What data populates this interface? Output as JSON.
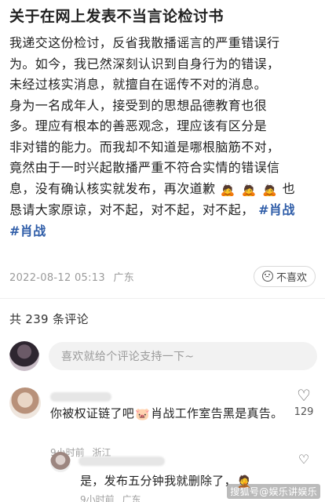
{
  "post": {
    "title": "关于在网上发表不当言论检讨书",
    "lines": [
      "我递交这份检讨，反省我散播谣言的严重错误行",
      "为。如今，我已然深刻认识到自身行为的错误，",
      "未经过核实消息，就擅自在谣传不对的消息。",
      "身为一名成年人，接受到的思想品德教育也很",
      "多。理应有根本的善恶观念，理应该有区分是",
      "非对错的能力。而我却不知道是哪根脑筋不对，",
      "竟然由于一时兴起散播严重不符合实情的错误信",
      "息，没有确认核实就发布，再次道歉",
      "恳请大家原谅，对不起，对不起，对不起，"
    ],
    "line8_tail": "也",
    "bow_emoji": "🙇",
    "hashtag_1": "#肖战",
    "hashtag_2": "#肖战",
    "date": "2022-08-12 05:13",
    "location": "广东",
    "dislike_label": "不喜欢"
  },
  "comments_header": {
    "count_label": "共 239 条评论"
  },
  "compose": {
    "placeholder": "喜欢就给个评论支持一下~"
  },
  "comments": [
    {
      "text_before": "你被权证链了吧",
      "emoji": "🐷",
      "text_after": "肖战工作室告黑是真告。",
      "time": "9小时前",
      "location": "浙江",
      "likes": "129",
      "reply": {
        "text": "是，发布五分钟我就删除了，",
        "emoji": "🤦",
        "time": "9小时前",
        "location": "广东"
      }
    }
  ],
  "watermark": "搜狐号@娱乐讲娱乐",
  "icons": {
    "dislike": "dislike-face-icon",
    "like": "heart-icon"
  }
}
